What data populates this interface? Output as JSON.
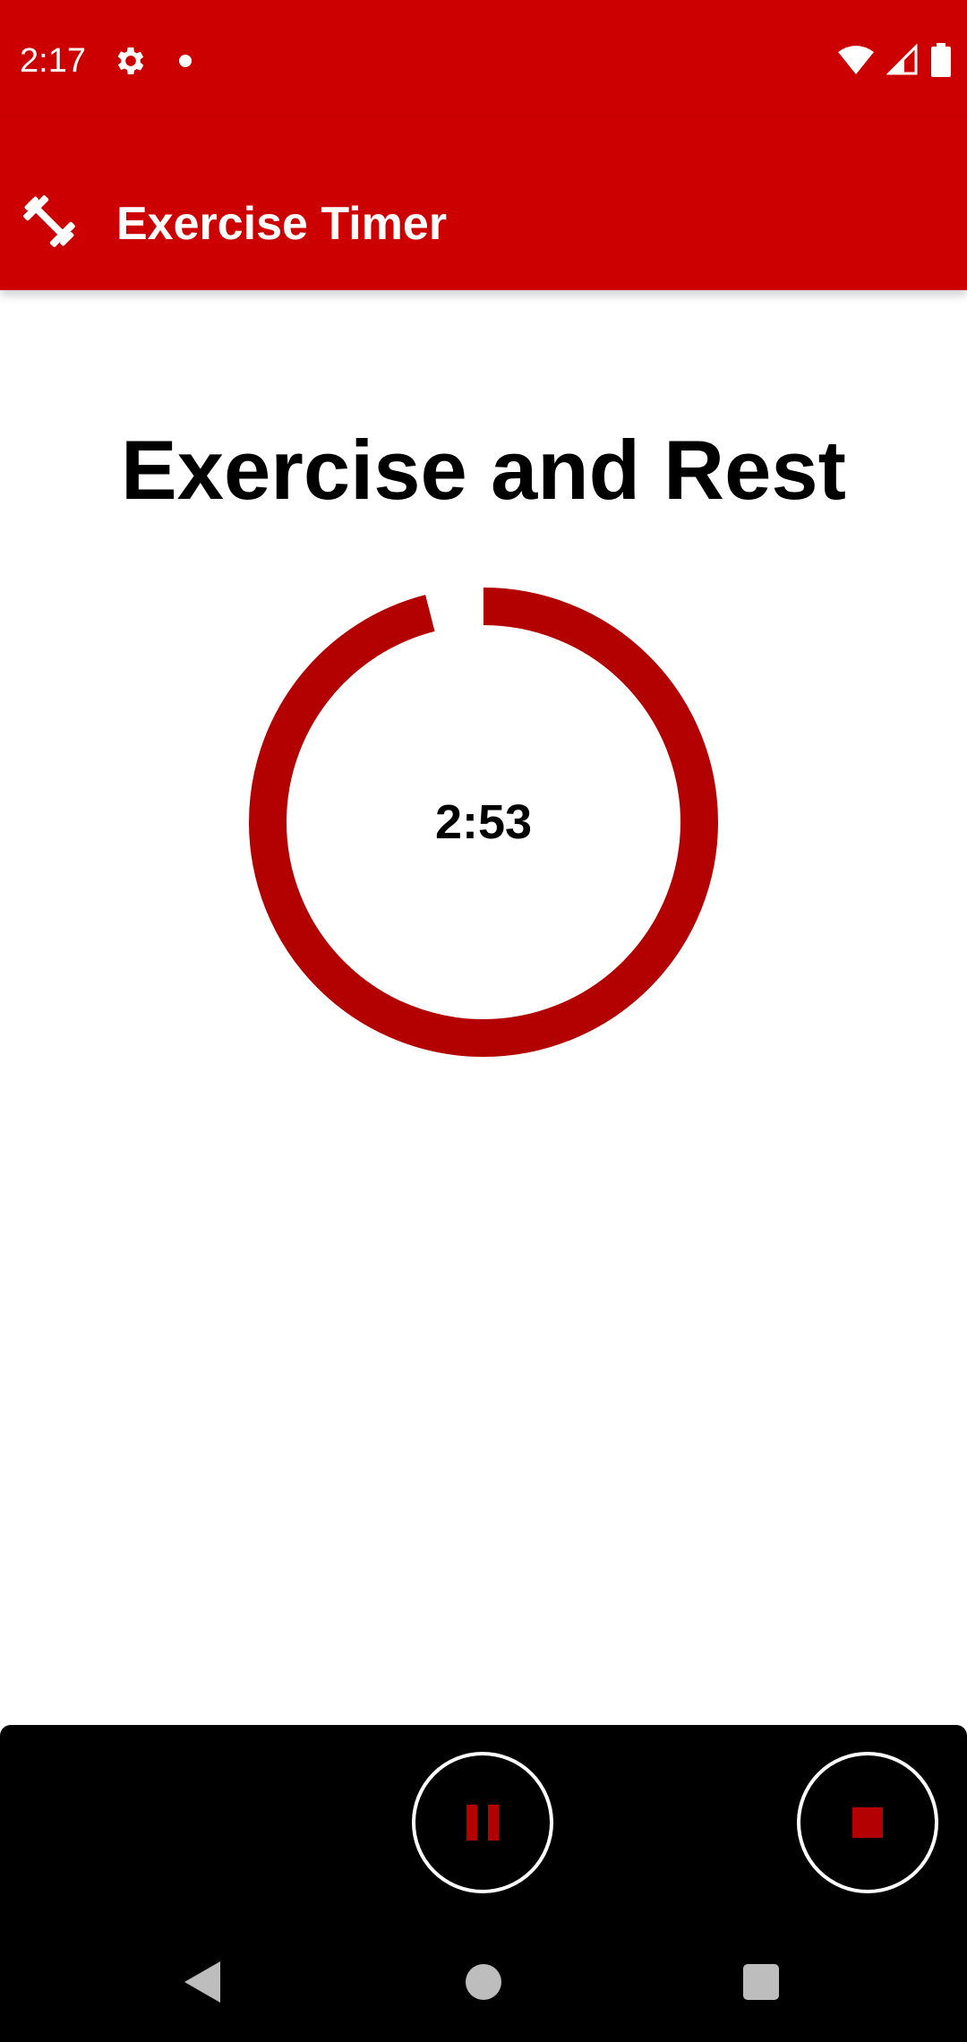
{
  "status_bar": {
    "time": "2:17",
    "icons": [
      "gear-icon",
      "notification-dot-icon",
      "wifi-icon",
      "cell-signal-icon",
      "battery-icon"
    ]
  },
  "app_bar": {
    "title": "Exercise Timer",
    "icon": "dumbbell-icon",
    "color": "#cc0000"
  },
  "main": {
    "title": "Exercise and Rest",
    "timer": {
      "remaining": "2:53",
      "progress_fraction": 0.96,
      "ring_color": "#b30000"
    }
  },
  "controls": {
    "pause_icon": "pause-icon",
    "stop_icon": "stop-icon",
    "accent_color": "#b30000"
  },
  "nav_bar": {
    "icons": [
      "back-icon",
      "home-icon",
      "recents-icon"
    ]
  }
}
